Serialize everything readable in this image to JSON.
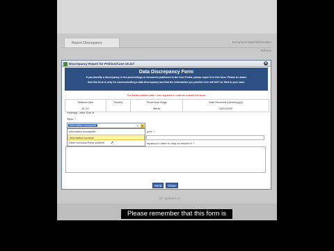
{
  "background": {
    "tab_label": "Report Discrepancy",
    "right_text_1": "Document index/Information",
    "right_text_2": "Refresh",
    "bottom_text": "ref. Updated on"
  },
  "dialog": {
    "title": "Discrepancy Report for Petition/Case 15.117",
    "close_icon": "close-icon"
  },
  "form": {
    "heading": "Data Discrepancy Form",
    "intro_line1": "If you identify a discrepancy in the proceedings or document published in the User Portal, please report it in this form. Please be aware",
    "intro_line2": "that this form is only for communicating a data discrepancy and that the information you provide here will NOT be filed in your case.",
    "required_note": "The fields marked with * are required in order to submit the form.",
    "table": {
      "headers": [
        "Petition/Case",
        "Country",
        "Procedural Stage",
        "Date Received (dd/mm/yyyy)"
      ],
      "values": [
        "15.117",
        "",
        "Merits",
        "28/11/2020"
      ]
    },
    "victims_label": "Victim(s): John Doe Jr.",
    "topic_label": "Topic: *",
    "topic_selected": "Information incomplete",
    "topic_options": [
      "Information incomplete",
      "Information incorrect",
      "Other technical Portal problem"
    ],
    "report_label": "port: *",
    "describe_label": "repancy in order to help us resolve it: *",
    "send_label": "Send",
    "close_label": "Close"
  },
  "subtitle": "Please remember that this form is"
}
